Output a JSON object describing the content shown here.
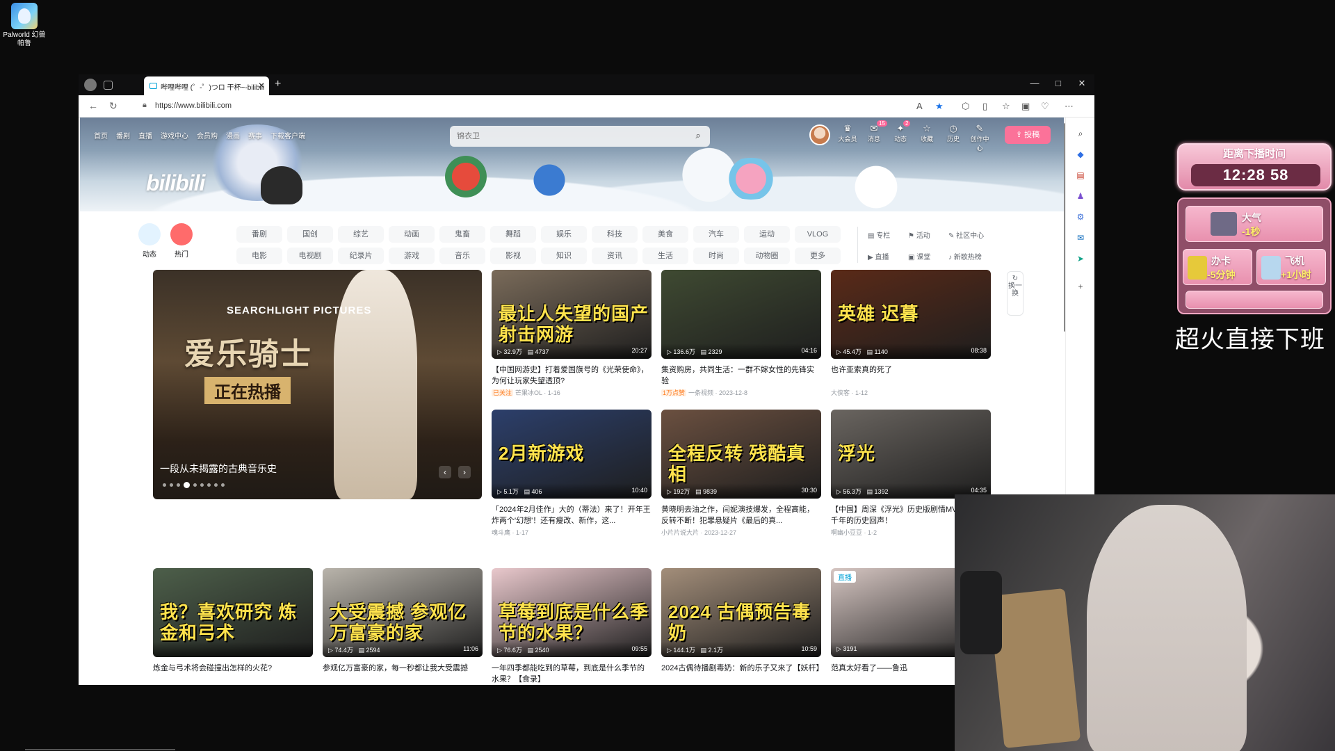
{
  "desktop": {
    "icon_label": "Palworld 幻兽帕鲁"
  },
  "browser": {
    "tab_title": "哔哩哔哩 (゜-゜)つロ 干杯~-bilibili",
    "new_tab": "+",
    "url": "https://www.bilibili.com",
    "win_min": "—",
    "win_max": "□",
    "win_close": "✕"
  },
  "header": {
    "logo": "bilibili",
    "nav": [
      "首页",
      "番剧",
      "直播",
      "游戏中心",
      "会员购",
      "漫画",
      "赛事",
      "下载客户端"
    ],
    "search_placeholder": "锦衣卫",
    "right_nav": [
      {
        "label": "大会员",
        "icon": "crown-icon",
        "glyph": "♛"
      },
      {
        "label": "消息",
        "icon": "message-icon",
        "glyph": "✉",
        "badge": "15"
      },
      {
        "label": "动态",
        "icon": "dynamic-icon",
        "glyph": "✦",
        "badge": "2"
      },
      {
        "label": "收藏",
        "icon": "star-icon",
        "glyph": "☆"
      },
      {
        "label": "历史",
        "icon": "history-icon",
        "glyph": "◷"
      },
      {
        "label": "创作中心",
        "icon": "bulb-icon",
        "glyph": "✎"
      }
    ],
    "upload_label": "投稿"
  },
  "channels": {
    "main": [
      {
        "label": "动态",
        "color": "#e3f3ff"
      },
      {
        "label": "热门",
        "color": "#ff6b6b"
      }
    ],
    "row1": [
      "番剧",
      "国创",
      "综艺",
      "动画",
      "鬼畜",
      "舞蹈",
      "娱乐",
      "科技",
      "美食",
      "汽车",
      "运动",
      "VLOG"
    ],
    "row2": [
      "电影",
      "电视剧",
      "纪录片",
      "游戏",
      "音乐",
      "影视",
      "知识",
      "资讯",
      "生活",
      "时尚",
      "动物圈",
      "更多"
    ],
    "side1": [
      "专栏",
      "活动",
      "社区中心"
    ],
    "side2": [
      "直播",
      "课堂",
      "新歌热榜"
    ]
  },
  "carousel": {
    "brand": "SEARCHLIGHT PICTURES",
    "big_title": "爱乐骑士",
    "sub_title": "正在热播",
    "caption": "一段从未揭露的古典音乐史",
    "prev": "‹",
    "next": "›"
  },
  "refresh": {
    "label": "换一换"
  },
  "videos": [
    {
      "thumb_text": "最让人失望的国产射击网游",
      "views": "32.9万",
      "danmaku": "4737",
      "duration": "20:27",
      "title": "【中国网游史】打着爱国旗号的《光荣使命》，为何让玩家失望透顶?",
      "tag": "已关注",
      "uploader": "芒果冰OL",
      "date": "1-16",
      "bg": "#7a6b5a"
    },
    {
      "thumb_text": "",
      "views": "136.6万",
      "danmaku": "2329",
      "duration": "04:16",
      "title": "集资购房，共同生活：一群不嫁女性的先锋实验",
      "tag": "1万点赞",
      "uploader": "一条视频",
      "date": "2023-12-8",
      "bg": "#3f4a32"
    },
    {
      "thumb_text": "英雄 迟暮",
      "views": "45.4万",
      "danmaku": "1140",
      "duration": "08:38",
      "title": "也许亚索真的死了",
      "tag": "",
      "uploader": "大侠客",
      "date": "1-12",
      "bg": "#5a2a18"
    },
    {
      "thumb_text": "2月新游戏",
      "views": "5.1万",
      "danmaku": "406",
      "duration": "10:40",
      "title": "「2024年2月佳作」大的（蒂法）来了！开年王炸两个'幻想'！还有瘦改、新作，这...",
      "tag": "",
      "uploader": "魂斗鹰",
      "date": "1-17",
      "bg": "#2c3f6b"
    },
    {
      "thumb_text": "全程反转 残酷真相",
      "views": "192万",
      "danmaku": "9839",
      "duration": "30:30",
      "title": "黄晓明去油之作，闫妮演技爆发，全程高能，反转不断！犯罪悬疑片《最后的真...",
      "tag": "",
      "uploader": "小片片说大片",
      "date": "2023-12-27",
      "bg": "#6b5040"
    },
    {
      "thumb_text": "浮光",
      "views": "56.3万",
      "danmaku": "1392",
      "duration": "04:35",
      "title": "【中国】周深《浮光》历史版剧情MV！这是五千年的历史回声！",
      "tag": "",
      "uploader": "啊幽小豆豆",
      "date": "1-2",
      "bg": "#6a6560"
    },
    {
      "thumb_text": "我？喜欢研究 炼金和弓术",
      "views": "",
      "danmaku": "",
      "duration": "",
      "title": "炼金与弓术将会碰撞出怎样的火花?",
      "tag": "",
      "uploader": "",
      "date": "",
      "bg": "#4d5f4a"
    },
    {
      "thumb_text": "大受震撼 参观亿万富豪的家",
      "views": "74.4万",
      "danmaku": "2594",
      "duration": "11:06",
      "title": "参观亿万富豪的家，每一秒都让我大受震撼",
      "tag": "",
      "uploader": "",
      "date": "",
      "bg": "#b9b4ab"
    },
    {
      "thumb_text": "草莓到底是什么季节的水果？",
      "views": "76.6万",
      "danmaku": "2540",
      "duration": "09:55",
      "title": "一年四季都能吃到的草莓，到底是什么季节的水果？【食录】",
      "tag": "",
      "uploader": "",
      "date": "",
      "bg": "#e9c8cc"
    },
    {
      "thumb_text": "2024 古偶预告毒奶",
      "views": "144.1万",
      "danmaku": "2.1万",
      "duration": "10:59",
      "title": "2024古偶待播剧毒奶：新的乐子又来了【妖杆】",
      "tag": "",
      "uploader": "",
      "date": "",
      "bg": "#a38e7a"
    },
    {
      "thumb_text": "",
      "views": "3191",
      "danmaku": "",
      "duration": "",
      "title": "范真太好看了——鲁迅",
      "tag": "直播中",
      "uploader": "",
      "date": "",
      "bg": "#d6c6c2",
      "live_badge": "直播"
    }
  ],
  "overlay": {
    "timer_label": "距离下播时间",
    "timer_value": "12:28 58",
    "items": [
      {
        "name": "大气",
        "value": "-1秒"
      },
      {
        "name": "办卡",
        "value": "-5分钟"
      },
      {
        "name": "飞机",
        "value": "+1小时"
      }
    ],
    "caption": "超火直接下班"
  },
  "colors": {
    "accent": "#fb7299",
    "link": "#00a1d6",
    "overlay_pink": "#e28aa9"
  }
}
